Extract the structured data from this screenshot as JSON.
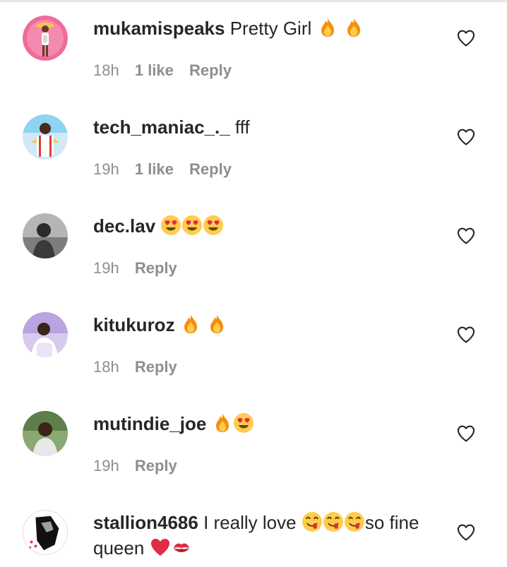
{
  "comments": [
    {
      "username": "mukamispeaks",
      "text": "Pretty Girl",
      "emojis": [
        "fire-emoji",
        "fire-emoji"
      ],
      "time": "18h",
      "likes": "1 like",
      "reply": "Reply",
      "avatar_bg": "#f06b9a"
    },
    {
      "username": "tech_maniac_._",
      "text": "fff",
      "emojis": [],
      "time": "19h",
      "likes": "1 like",
      "reply": "Reply",
      "avatar_bg": "#8fd3f2"
    },
    {
      "username": "dec.lav",
      "text": "",
      "emojis": [
        "heart-eyes-emoji",
        "heart-eyes-emoji",
        "heart-eyes-emoji"
      ],
      "time": "19h",
      "likes": "",
      "reply": "Reply",
      "avatar_bg": "#9a9a9a"
    },
    {
      "username": "kitukuroz",
      "text": "",
      "emojis": [
        "fire-emoji",
        "fire-emoji"
      ],
      "time": "18h",
      "likes": "",
      "reply": "Reply",
      "avatar_bg": "#c9b6e6"
    },
    {
      "username": "mutindie_joe",
      "text": "",
      "emojis": [
        "fire-emoji",
        "heart-eyes-emoji"
      ],
      "time": "19h",
      "likes": "",
      "reply": "Reply",
      "avatar_bg": "#6f8f5a"
    },
    {
      "username": "stallion4686",
      "text": "I really love",
      "emojis": [
        "yum-emoji",
        "yum-emoji",
        "yum-emoji"
      ],
      "text_after": "so fine queen",
      "trailing_emojis": [
        "red-heart-emoji",
        "kiss-mark-emoji"
      ],
      "time": "",
      "likes": "",
      "reply": "",
      "avatar_bg": "#ffffff"
    }
  ],
  "colors": {
    "username": "#262626",
    "meta": "#8e8e8e",
    "divider": "#e6e6e6"
  }
}
